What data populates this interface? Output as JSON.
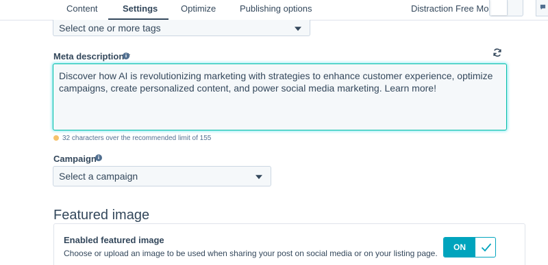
{
  "tabs": [
    {
      "label": "Content",
      "active": false
    },
    {
      "label": "Settings",
      "active": true
    },
    {
      "label": "Optimize",
      "active": false
    },
    {
      "label": "Publishing options",
      "active": false
    }
  ],
  "distraction_free": {
    "label": "Distraction Free Mode"
  },
  "tags": {
    "placeholder": "Select one or more tags"
  },
  "meta_description": {
    "label": "Meta description *",
    "value": "Discover how AI is revolutionizing marketing with strategies to enhance customer experience, optimize campaigns, create personalized content, and power social media marketing. Learn more!",
    "warning": "32 characters over the recommended limit of 155"
  },
  "campaign": {
    "label": "Campaign",
    "placeholder": "Select a campaign"
  },
  "featured_image": {
    "section_title": "Featured image",
    "card_title": "Enabled featured image",
    "card_description": "Choose or upload an image to be used when sharing your post on social media or on your listing page.",
    "toggle_label": "ON",
    "toggle_on": true
  },
  "colors": {
    "accent": "#00a4bd",
    "text": "#33475b",
    "warning_dot": "#f5c26b",
    "focus_border": "#00bda5"
  },
  "icons": [
    "info-icon",
    "refresh-icon",
    "caret-down-icon",
    "check-icon",
    "chat-icon"
  ]
}
